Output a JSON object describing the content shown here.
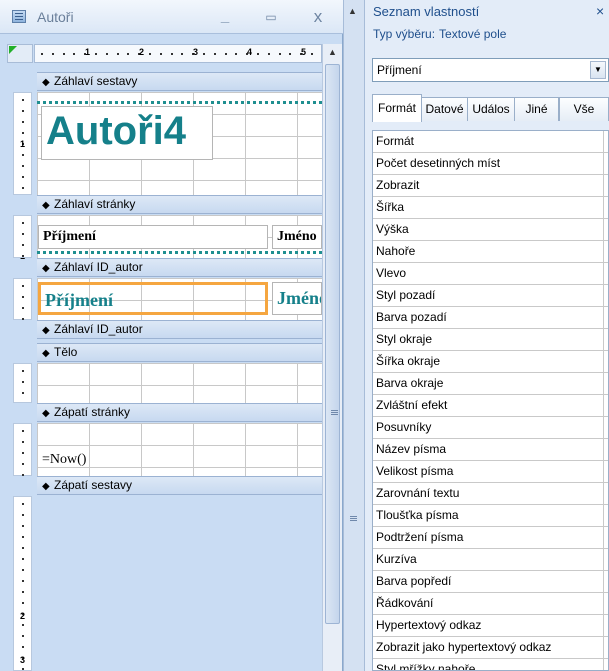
{
  "report_window": {
    "title": "Autoři",
    "minimize": "_",
    "maximize": "▭",
    "close": "x"
  },
  "ruler": {
    "numbers": [
      "1",
      "2",
      "3",
      "4",
      "5"
    ],
    "vertical_numbers": [
      "1",
      "1",
      "2",
      "3"
    ]
  },
  "sections": {
    "report_header": "Záhlaví sestavy",
    "page_header": "Záhlaví stránky",
    "group_header": "Záhlaví ID_autor",
    "group_footer": "Záhlaví ID_autor",
    "detail": "Tělo",
    "page_footer": "Zápatí stránky",
    "report_footer": "Zápatí sestavy"
  },
  "controls": {
    "report_title": "Autoři4",
    "header_surname": "Příjmení",
    "header_name": "Jméno",
    "field_surname": "Příjmení",
    "field_name": "Jméno",
    "now_expr": "=Now()"
  },
  "property_sheet": {
    "title": "Seznam vlastností",
    "close": "×",
    "selection_type_label": "Typ výběru:",
    "selection_type_value": "Textové pole",
    "selected_object": "Příjmení",
    "tabs": [
      "Formát",
      "Datové",
      "Událos",
      "Jiné",
      "Vše"
    ],
    "active_tab": "Formát",
    "properties": [
      "Formát",
      "Počet desetinných míst",
      "Zobrazit",
      "Šířka",
      "Výška",
      "Nahoře",
      "Vlevo",
      "Styl pozadí",
      "Barva pozadí",
      "Styl okraje",
      "Šířka okraje",
      "Barva okraje",
      "Zvláštní efekt",
      "Posuvníky",
      "Název písma",
      "Velikost písma",
      "Zarovnání textu",
      "Tloušťka písma",
      "Podtržení písma",
      "Kurzíva",
      "Barva popředí",
      "Řádkování",
      "Hypertextový odkaz",
      "Zobrazit jako hypertextový odkaz",
      "Styl mřížky nahoře"
    ]
  },
  "colors": {
    "accent_teal": "#15808a",
    "selection_orange": "#f5a640",
    "section_bar": "#c7d9f0"
  }
}
